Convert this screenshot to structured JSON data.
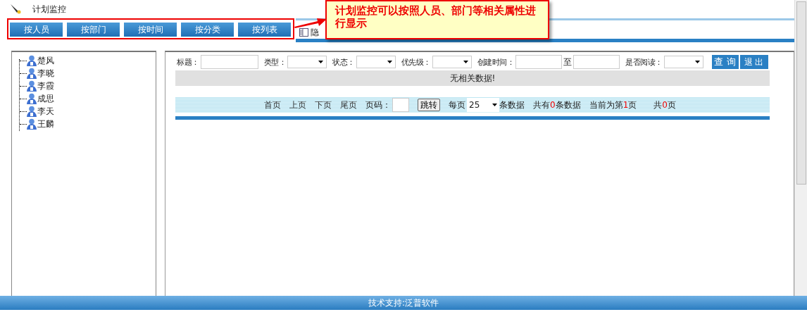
{
  "header": {
    "title": "计划监控"
  },
  "view_buttons": [
    {
      "label": "按人员"
    },
    {
      "label": "按部门"
    },
    {
      "label": "按时间"
    },
    {
      "label": "按分类"
    },
    {
      "label": "按列表"
    }
  ],
  "hide_toggle": {
    "label": "隐"
  },
  "callout": {
    "text": "计划监控可以按照人员、部门等相关属性进行显示"
  },
  "tree": {
    "items": [
      {
        "label": "楚风"
      },
      {
        "label": "李晓"
      },
      {
        "label": "李霞"
      },
      {
        "label": "成思"
      },
      {
        "label": "李天"
      },
      {
        "label": "王麟"
      }
    ]
  },
  "filters": [
    {
      "kind": "input",
      "label": "标题："
    },
    {
      "kind": "select",
      "label": "类型："
    },
    {
      "kind": "select",
      "label": "状态："
    },
    {
      "kind": "select",
      "label": "优先级："
    },
    {
      "kind": "range",
      "label": "创建时间：",
      "between": "至"
    },
    {
      "kind": "select",
      "label": "是否阅读："
    }
  ],
  "query_button": {
    "label": "查 询"
  },
  "exit_button": {
    "label": "退 出"
  },
  "empty_message": "无相关数据!",
  "pager": {
    "links": [
      "首页",
      "上页",
      "下页",
      "尾页"
    ],
    "page_label": "页码：",
    "jump_button": "跳转",
    "per_page_label": "每页",
    "per_page_value": "25",
    "per_page_suffix": "条数据",
    "summaries": [
      [
        {
          "text": "共有",
          "highlight": false
        },
        {
          "text": "0",
          "highlight": true
        },
        {
          "text": "条数据",
          "highlight": false
        }
      ],
      [
        {
          "text": "当前为第",
          "highlight": false
        },
        {
          "text": "1",
          "highlight": true
        },
        {
          "text": "页",
          "highlight": false
        }
      ],
      [
        {
          "text": "共",
          "highlight": false
        },
        {
          "text": "0",
          "highlight": true
        },
        {
          "text": "页",
          "highlight": false
        }
      ]
    ]
  },
  "footer": {
    "text": "技术支持:泛普软件"
  }
}
